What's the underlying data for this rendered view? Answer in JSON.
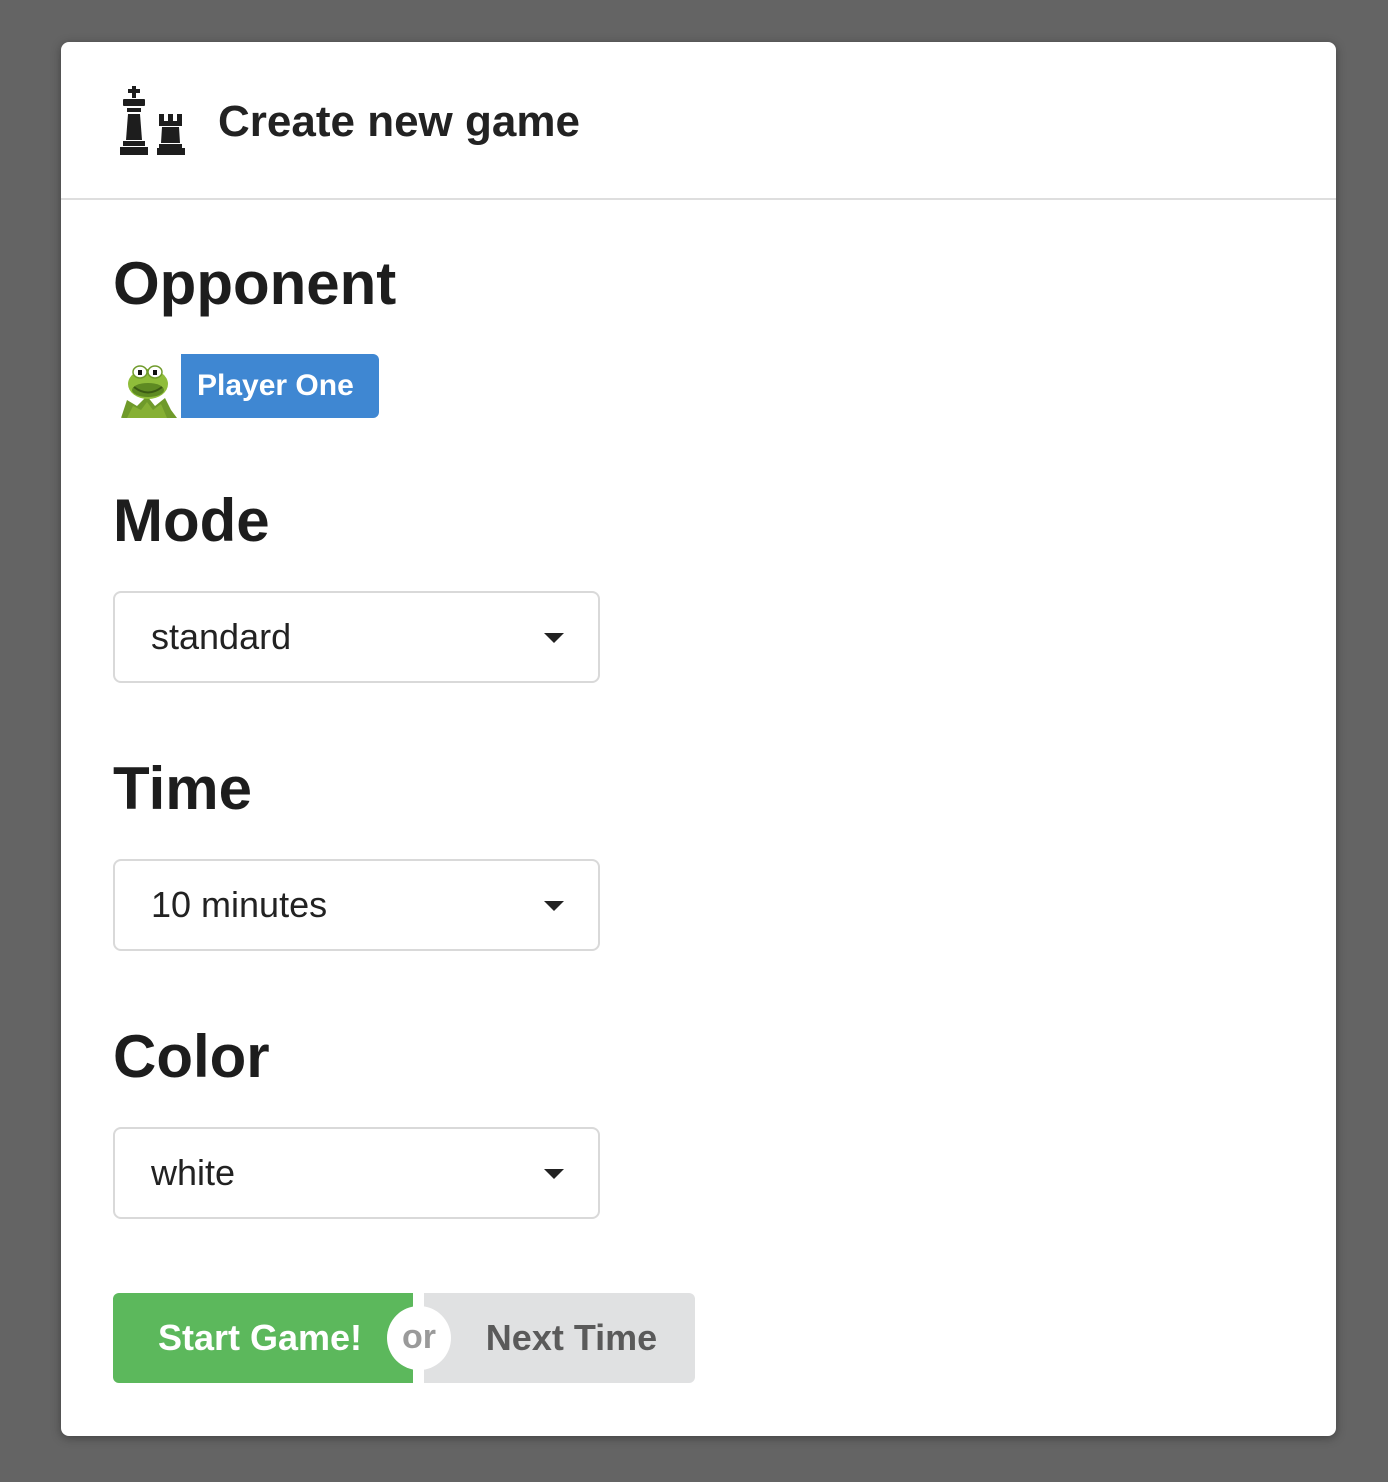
{
  "modal": {
    "title": "Create new game",
    "header_icon": "chess-king-rook-icon"
  },
  "opponent": {
    "heading": "Opponent",
    "player_name": "Player One",
    "avatar_icon": "frog-avatar",
    "chip_color": "#3f87d2"
  },
  "mode": {
    "heading": "Mode",
    "selected": "standard"
  },
  "time": {
    "heading": "Time",
    "selected": "10 minutes"
  },
  "color": {
    "heading": "Color",
    "selected": "white"
  },
  "actions": {
    "start_label": "Start Game!",
    "or_label": "or",
    "cancel_label": "Next Time",
    "start_color": "#5cb85c",
    "cancel_color": "#e0e1e2"
  }
}
